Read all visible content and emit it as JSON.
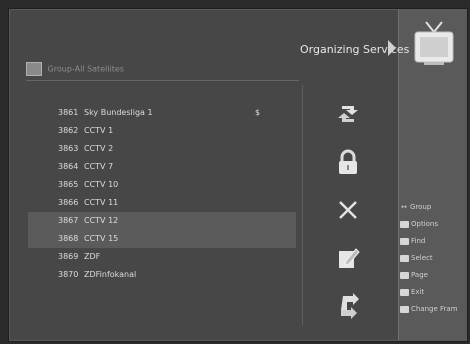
{
  "header": {
    "title": "Organizing Services"
  },
  "group": {
    "label": "Group-All Satellites"
  },
  "channels": [
    {
      "num": "3861",
      "name": "Sky Bundesliga 1",
      "flag": "$",
      "highlighted": false
    },
    {
      "num": "3862",
      "name": "CCTV 1",
      "flag": "",
      "highlighted": false
    },
    {
      "num": "3863",
      "name": "CCTV 2",
      "flag": "",
      "highlighted": false
    },
    {
      "num": "3864",
      "name": "CCTV 7",
      "flag": "",
      "highlighted": false
    },
    {
      "num": "3865",
      "name": "CCTV 10",
      "flag": "",
      "highlighted": false
    },
    {
      "num": "3866",
      "name": "CCTV 11",
      "flag": "",
      "highlighted": false
    },
    {
      "num": "3867",
      "name": "CCTV 12",
      "flag": "",
      "highlighted": true
    },
    {
      "num": "3868",
      "name": "CCTV 15",
      "flag": "",
      "highlighted": true
    },
    {
      "num": "3869",
      "name": "ZDF",
      "flag": "",
      "highlighted": false
    },
    {
      "num": "3870",
      "name": "ZDFinfokanal",
      "flag": "",
      "highlighted": false
    }
  ],
  "actions": [
    {
      "name": "move-icon"
    },
    {
      "name": "lock-icon"
    },
    {
      "name": "delete-icon"
    },
    {
      "name": "rename-icon"
    },
    {
      "name": "skip-icon"
    }
  ],
  "legend": [
    {
      "key": "↔",
      "label": "Group"
    },
    {
      "key": "",
      "label": "Options"
    },
    {
      "key": "",
      "label": "Find"
    },
    {
      "key": "",
      "label": "Select"
    },
    {
      "key": "",
      "label": "Page"
    },
    {
      "key": "",
      "label": "Exit"
    },
    {
      "key": "",
      "label": "Change Fram"
    }
  ],
  "colors": {
    "panel": "#474747",
    "highlight": "#5b5b5b",
    "sidebar": "#5a5a5a"
  }
}
